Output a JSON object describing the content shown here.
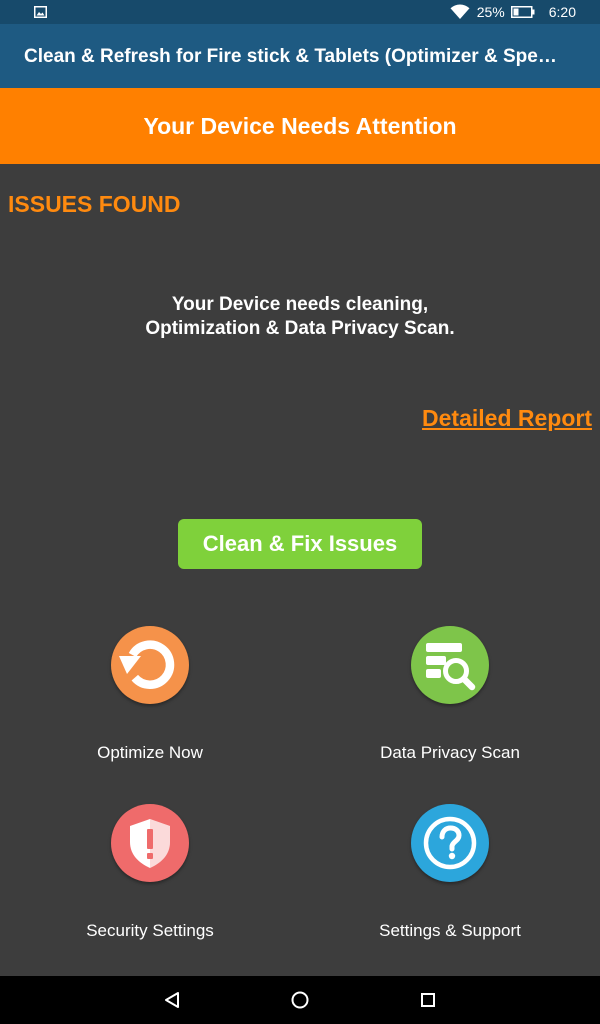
{
  "status_bar": {
    "notification_icon": "image-icon",
    "wifi_icon": "wifi-icon",
    "battery_percent": "25%",
    "battery_icon": "battery-icon",
    "time": "6:20"
  },
  "app_bar": {
    "title": "Clean & Refresh for Fire stick & Tablets (Optimizer & Speed Booster)"
  },
  "banner": {
    "text": "Your Device Needs Attention"
  },
  "issues": {
    "heading": "ISSUES FOUND",
    "message_line1": "Your Device needs cleaning,",
    "message_line2": "Optimization & Data Privacy Scan.",
    "report_link": "Detailed Report"
  },
  "action": {
    "clean_label": "Clean & Fix Issues"
  },
  "tiles": [
    {
      "label": "Optimize Now",
      "icon": "refresh-icon"
    },
    {
      "label": "Data Privacy Scan",
      "icon": "data-search-icon"
    },
    {
      "label": "Security Settings",
      "icon": "shield-alert-icon"
    },
    {
      "label": "Settings & Support",
      "icon": "question-icon"
    }
  ],
  "nav_bar": {
    "back_icon": "back-triangle-icon",
    "home_icon": "home-circle-icon",
    "recents_icon": "recents-square-icon"
  },
  "colors": {
    "status_bar": "#174a6b",
    "app_bar": "#1e5a82",
    "banner": "#ff8000",
    "accent_orange": "#ff8a0f",
    "button_green": "#7fd13b",
    "background": "#3d3d3d"
  }
}
